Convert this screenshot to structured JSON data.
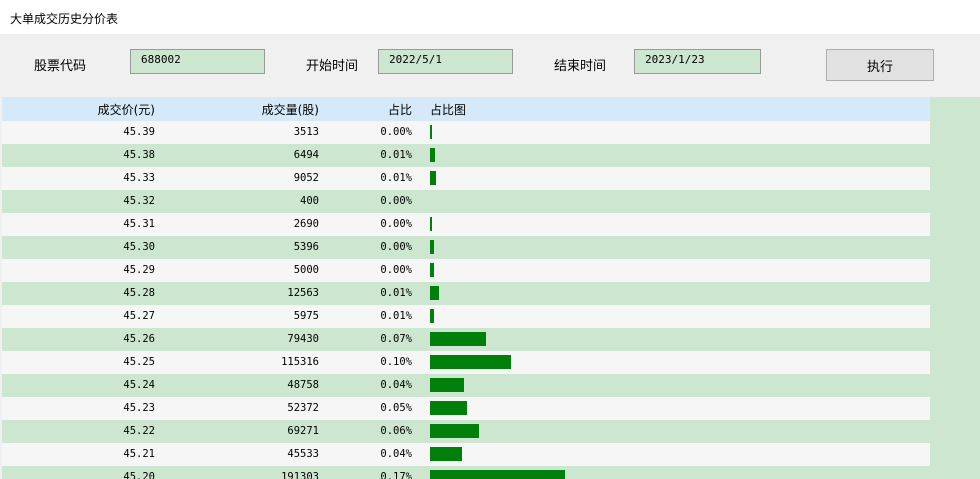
{
  "window": {
    "title": "大单成交历史分价表"
  },
  "form": {
    "code_label": "股票代码",
    "code_value": "688002",
    "start_label": "开始时间",
    "start_value": "2022/5/1",
    "end_label": "结束时间",
    "end_value": "2023/1/23",
    "run_label": "执行"
  },
  "table": {
    "headers": [
      "成交价(元)",
      "成交量(股)",
      "占比",
      "占比图"
    ],
    "max_volume": 191303,
    "rows": [
      {
        "price": "45.39",
        "volume": "3513",
        "pct": "0.00%",
        "vol": 3513
      },
      {
        "price": "45.38",
        "volume": "6494",
        "pct": "0.01%",
        "vol": 6494
      },
      {
        "price": "45.33",
        "volume": "9052",
        "pct": "0.01%",
        "vol": 9052
      },
      {
        "price": "45.32",
        "volume": "400",
        "pct": "0.00%",
        "vol": 400
      },
      {
        "price": "45.31",
        "volume": "2690",
        "pct": "0.00%",
        "vol": 2690
      },
      {
        "price": "45.30",
        "volume": "5396",
        "pct": "0.00%",
        "vol": 5396
      },
      {
        "price": "45.29",
        "volume": "5000",
        "pct": "0.00%",
        "vol": 5000
      },
      {
        "price": "45.28",
        "volume": "12563",
        "pct": "0.01%",
        "vol": 12563
      },
      {
        "price": "45.27",
        "volume": "5975",
        "pct": "0.01%",
        "vol": 5975
      },
      {
        "price": "45.26",
        "volume": "79430",
        "pct": "0.07%",
        "vol": 79430
      },
      {
        "price": "45.25",
        "volume": "115316",
        "pct": "0.10%",
        "vol": 115316
      },
      {
        "price": "45.24",
        "volume": "48758",
        "pct": "0.04%",
        "vol": 48758
      },
      {
        "price": "45.23",
        "volume": "52372",
        "pct": "0.05%",
        "vol": 52372
      },
      {
        "price": "45.22",
        "volume": "69271",
        "pct": "0.06%",
        "vol": 69271
      },
      {
        "price": "45.21",
        "volume": "45533",
        "pct": "0.04%",
        "vol": 45533
      },
      {
        "price": "45.20",
        "volume": "191303",
        "pct": "0.17%",
        "vol": 191303
      }
    ]
  },
  "colors": {
    "bar": "#00800b",
    "row_alt": "#cde6d0",
    "header": "#d5e9f8"
  }
}
